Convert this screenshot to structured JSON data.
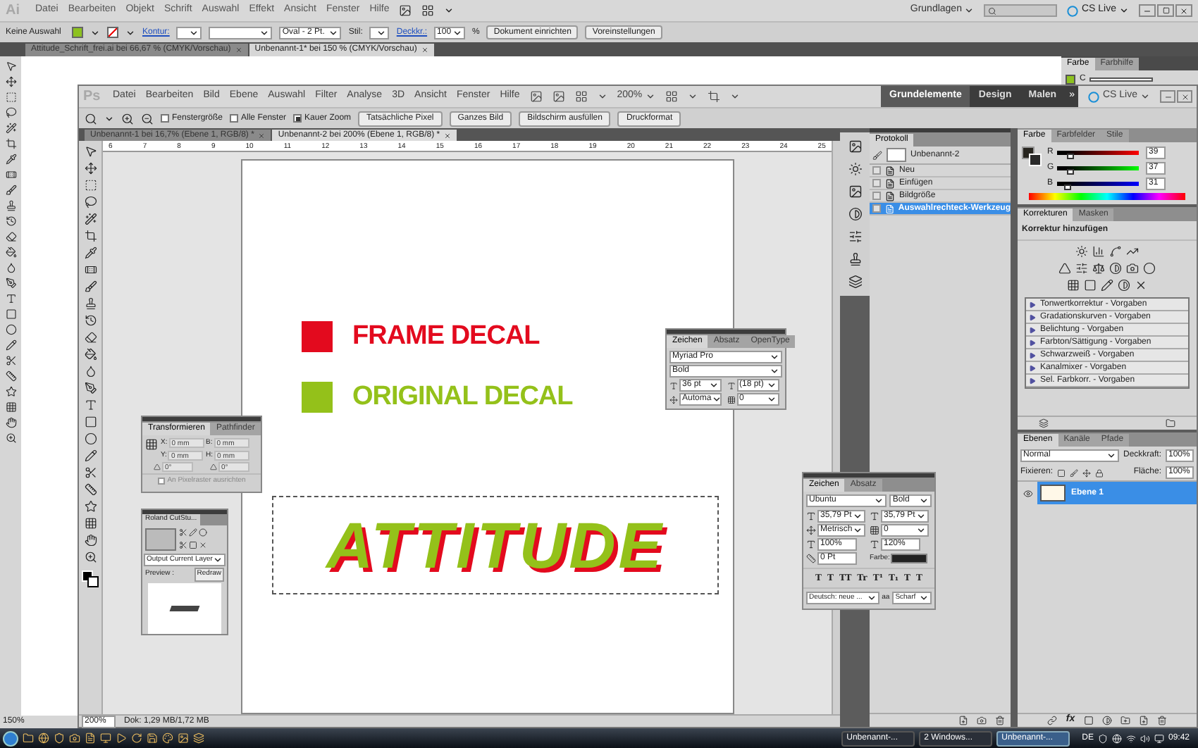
{
  "ai_app": {
    "logo": "Ai",
    "menu": [
      "Datei",
      "Bearbeiten",
      "Objekt",
      "Schrift",
      "Auswahl",
      "Effekt",
      "Ansicht",
      "Fenster",
      "Hilfe"
    ],
    "workspace": "Grundlagen",
    "cs_live": "CS Live",
    "control_bar": {
      "selection": "Keine Auswahl",
      "stroke_label": "Kontur:",
      "brush": "Oval - 2 Pt.",
      "style_label": "Stil:",
      "opacity_label": "Deckkr.:",
      "opacity": "100",
      "percent": "%",
      "buttons": [
        "Dokument einrichten",
        "Voreinstellungen"
      ]
    },
    "tabs": [
      {
        "label": "Attitude_Schrift_frei.ai bei 66,67 % (CMYK/Vorschau)",
        "selected": false
      },
      {
        "label": "Unbenannt-1* bei 150 % (CMYK/Vorschau)",
        "selected": true
      }
    ],
    "color_panel": {
      "tabs": [
        {
          "label": "Farbe",
          "selected": true
        },
        {
          "label": "Farbhilfe",
          "selected": false
        }
      ],
      "channel": "C"
    },
    "zoom": "150%"
  },
  "ps_app": {
    "logo": "Ps",
    "menu": [
      "Datei",
      "Bearbeiten",
      "Bild",
      "Ebene",
      "Auswahl",
      "Filter",
      "Analyse",
      "3D",
      "Ansicht",
      "Fenster",
      "Hilfe"
    ],
    "zoom_menu": "200%",
    "workspaces": [
      {
        "label": "Grundelemente",
        "selected": true
      },
      {
        "label": "Design",
        "selected": false
      },
      {
        "label": "Malen",
        "selected": false
      }
    ],
    "more": "»",
    "cs_live": "CS Live",
    "options": {
      "checkboxes": [
        {
          "label": "Fenstergröße",
          "checked": false
        },
        {
          "label": "Alle Fenster",
          "checked": false
        },
        {
          "label": "Kauer Zoom",
          "checked": true
        }
      ],
      "buttons": [
        "Tatsächliche Pixel",
        "Ganzes Bild",
        "Bildschirm ausfüllen",
        "Druckformat"
      ]
    },
    "doc_tabs": [
      {
        "label": "Unbenannt-1 bei 16,7% (Ebene 1, RGB/8) *",
        "selected": false
      },
      {
        "label": "Unbenannt-2 bei 200% (Ebene 1, RGB/8) *",
        "selected": true
      }
    ],
    "ruler": [
      "6",
      "7",
      "8",
      "9",
      "10",
      "11",
      "12",
      "13",
      "14",
      "15",
      "16",
      "17",
      "18",
      "19",
      "20",
      "21",
      "22",
      "23",
      "24",
      "25"
    ],
    "canvas": {
      "legend": [
        {
          "label": "FRAME DECAL",
          "color": "#e30a1e"
        },
        {
          "label": "ORIGINAL DECAL",
          "color": "#94c11a"
        }
      ],
      "artwork": "ATTITUDE"
    },
    "status": {
      "zoom": "200%",
      "doc": "Dok: 1,29 MB/1,72 MB"
    },
    "history": {
      "tab": "Protokoll",
      "snapshot": "Unbenannt-2",
      "items": [
        {
          "label": "Neu",
          "selected": false
        },
        {
          "label": "Einfügen",
          "selected": false
        },
        {
          "label": "Bildgröße",
          "selected": false
        },
        {
          "label": "Auswahlrechteck-Werkzeug",
          "selected": true
        }
      ]
    },
    "color": {
      "tabs": [
        {
          "label": "Farbe",
          "selected": true
        },
        {
          "label": "Farbfelder",
          "selected": false
        },
        {
          "label": "Stile",
          "selected": false
        }
      ],
      "channels": [
        {
          "name": "R",
          "value": "39",
          "level": 0.15
        },
        {
          "name": "G",
          "value": "37",
          "level": 0.15
        },
        {
          "name": "B",
          "value": "31",
          "level": 0.12
        }
      ]
    },
    "adjustments": {
      "tabs": [
        {
          "label": "Korrekturen",
          "selected": true
        },
        {
          "label": "Masken",
          "selected": false
        }
      ],
      "title": "Korrektur hinzufügen",
      "presets": [
        "Tonwertkorrektur - Vorgaben",
        "Gradationskurven - Vorgaben",
        "Belichtung - Vorgaben",
        "Farbton/Sättigung - Vorgaben",
        "Schwarzweiß - Vorgaben",
        "Kanalmixer - Vorgaben",
        "Sel. Farbkorr. - Vorgaben"
      ]
    },
    "layers": {
      "tabs": [
        {
          "label": "Ebenen",
          "selected": true
        },
        {
          "label": "Kanäle",
          "selected": false
        },
        {
          "label": "Pfade",
          "selected": false
        }
      ],
      "blend": "Normal",
      "opacity_label": "Deckkraft:",
      "opacity": "100%",
      "lock_label": "Fixieren:",
      "fill_label": "Fläche:",
      "fill": "100%",
      "fx": "fx",
      "items": [
        {
          "name": "Ebene 1",
          "selected": true
        }
      ]
    }
  },
  "transform_panel": {
    "tabs": [
      {
        "label": "Transformieren",
        "selected": true
      },
      {
        "label": "Pathfinder",
        "selected": false
      }
    ],
    "fields": [
      {
        "label": "X:",
        "value": "0 mm"
      },
      {
        "label": "B:",
        "value": "0 mm"
      },
      {
        "label": "Y:",
        "value": "0 mm"
      },
      {
        "label": "H:",
        "value": "0 mm"
      }
    ],
    "angles": [
      "0°",
      "0°"
    ],
    "checkbox": {
      "label": "An Pixelraster ausrichten",
      "checked": false
    }
  },
  "cutstudio_panel": {
    "title": "Roland CutStu...",
    "output": "Output Current Layer",
    "preview_label": "Preview :",
    "redraw": "Redraw"
  },
  "char_panel_small": {
    "tabs": [
      {
        "label": "Zeichen",
        "selected": true
      },
      {
        "label": "Absatz",
        "selected": false
      },
      {
        "label": "OpenType",
        "selected": false
      }
    ],
    "font": "Myriad Pro",
    "style": "Bold",
    "size": "36 pt",
    "leading": "(18 pt)",
    "kerning": "Automa",
    "tracking": "0"
  },
  "char_panel_large": {
    "tabs": [
      {
        "label": "Zeichen",
        "selected": true
      },
      {
        "label": "Absatz",
        "selected": false
      }
    ],
    "font": "Ubuntu",
    "style": "Bold",
    "size": "35,79 Pt",
    "leading": "35,79 Pt",
    "kerning": "Metrisch",
    "tracking": "0",
    "vscale": "100%",
    "hscale": "120%",
    "baseline": "0 Pt",
    "color_label": "Farbe:",
    "styles": [
      "T",
      "T",
      "TT",
      "Tr",
      "T¹",
      "T₁",
      "T",
      "T"
    ],
    "language": "Deutsch: neue ...",
    "antialias_icon": "aa",
    "antialias": "Scharf"
  },
  "taskbar": {
    "items": [
      {
        "label": "Unbenannt-...",
        "selected": false
      },
      {
        "label": "2 Windows...",
        "selected": false
      },
      {
        "label": "Unbenannt-...",
        "selected": true
      }
    ],
    "lang": "DE",
    "clock": "09:42"
  }
}
